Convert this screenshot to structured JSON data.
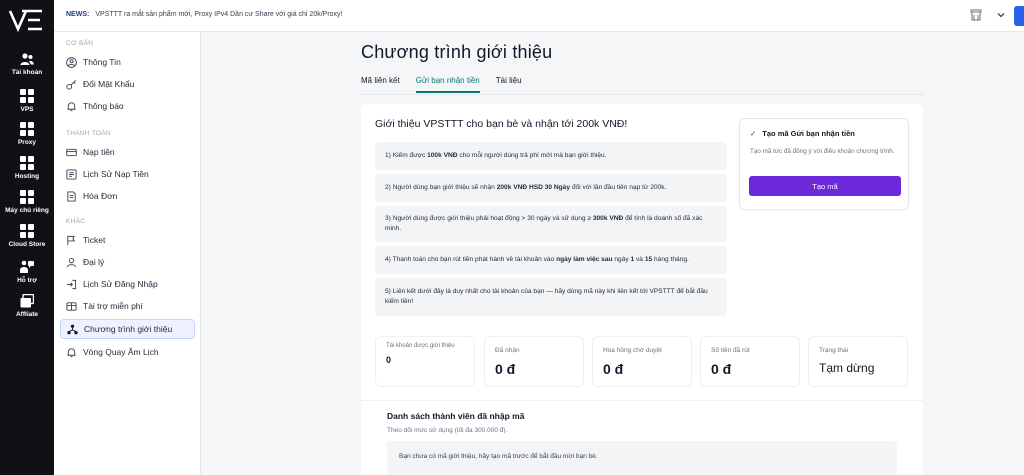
{
  "topbar": {
    "news_label": "NEWS:",
    "news_text": "VPSTTT ra mắt sản phẩm mới, Proxy IPv4 Dân cư Share với giá chỉ 20k/Proxy!"
  },
  "rail": {
    "items": [
      {
        "label": "Tài khoản",
        "icon": "users-icon"
      },
      {
        "label": "VPS",
        "icon": "grid-icon"
      },
      {
        "label": "Proxy",
        "icon": "grid-icon"
      },
      {
        "label": "Hosting",
        "icon": "grid-icon"
      },
      {
        "label": "Máy chủ riêng",
        "icon": "grid-icon"
      },
      {
        "label": "Cloud Store",
        "icon": "grid-icon"
      },
      {
        "label": "Hỗ trợ",
        "icon": "support-icon"
      },
      {
        "label": "Affliate",
        "icon": "window-icon"
      }
    ]
  },
  "sidebar": {
    "sections": [
      "CƠ BẢN",
      "THANH TOÁN",
      "KHÁC"
    ],
    "items": [
      {
        "label": "Thông Tin",
        "icon": "user-circle-icon"
      },
      {
        "label": "Đổi Mật Khẩu",
        "icon": "key-icon"
      },
      {
        "label": "Thông báo",
        "icon": "bell-icon"
      },
      {
        "label": "Nạp tiền",
        "icon": "card-icon"
      },
      {
        "label": "Lịch Sử Nạp Tiền",
        "icon": "history-icon"
      },
      {
        "label": "Hóa Đơn",
        "icon": "invoice-icon"
      },
      {
        "label": "Ticket",
        "icon": "ticket-icon"
      },
      {
        "label": "Đại lý",
        "icon": "agent-icon"
      },
      {
        "label": "Lịch Sử Đăng Nhập",
        "icon": "login-history-icon"
      },
      {
        "label": "Tài trợ miễn phí",
        "icon": "sponsor-icon"
      },
      {
        "label": "Chương trình giới thiệu",
        "icon": "network-icon"
      },
      {
        "label": "Vòng Quay Âm Lịch",
        "icon": "wheel-icon"
      }
    ]
  },
  "main": {
    "title": "Chương trình giới thiệu",
    "tabs": [
      "Mã liên kết",
      "Gửi bạn nhận tiền",
      "Tài liệu"
    ],
    "card_title": "Giới thiệu VPSTTT cho bạn bè và nhận tới 200k VNĐ!",
    "steps": [
      {
        "pre": "1) Kiếm được ",
        "bold": "100k VNĐ",
        "post": " cho mỗi người dùng trả phí mới mà bạn giới thiệu."
      },
      {
        "pre": "2) Người dùng bạn giới thiệu sẽ nhận ",
        "bold": "200k VNĐ HSD 30 Ngày",
        "post": " đối với lần đầu tiên nạp từ 200k."
      },
      {
        "pre": "3) Người dùng được giới thiệu phải hoạt động > 30 ngày và sử dụng ≥ ",
        "bold": "300k VNĐ",
        "post": " để tính là doanh số đã xác minh."
      },
      {
        "pre": "4) Thanh toán cho bạn rút tiền phát hành về tài khoản vào ",
        "bold": "ngày làm việc sau",
        "mid": " ngày ",
        "b2": "1",
        "mid2": " và ",
        "b3": "15",
        "post": " hàng tháng."
      },
      {
        "pre": "5) Liên kết dưới đây là duy nhất cho tài khoản của bạn — hãy dùng mã này khi liên kết tới VPSTTT để bắt đầu kiếm tiền!",
        "bold": "",
        "post": ""
      }
    ],
    "panel": {
      "title": "Tạo mã Gửi bạn nhận tiền",
      "subtitle": "Tạo mã tức đã đồng ý với điều khoản chương trình.",
      "button": "Tạo mã"
    },
    "stats": [
      {
        "label": "Tài khoản được giới thiệu",
        "value": "0"
      },
      {
        "label": "Đã nhận",
        "value": "0 đ"
      },
      {
        "label": "Hoa hồng chờ duyệt",
        "value": "0 đ"
      },
      {
        "label": "Số tiền đã rút",
        "value": "0 đ"
      },
      {
        "label": "Trạng thái",
        "value": "Tạm dừng"
      }
    ],
    "members": {
      "title": "Danh sách thành viên đã nhập mã",
      "subtitle": "Theo dõi mức sử dụng (tối đa 300.000 đ).",
      "empty": "Bạn chưa có mã giới thiệu, hãy tạo mã trước để bắt đầu mời bạn bè."
    }
  },
  "colors": {
    "rail_bg": "#0f1117",
    "accent_tab": "#0f766e",
    "button": "#6d28d9",
    "top_button": "#2563eb"
  }
}
